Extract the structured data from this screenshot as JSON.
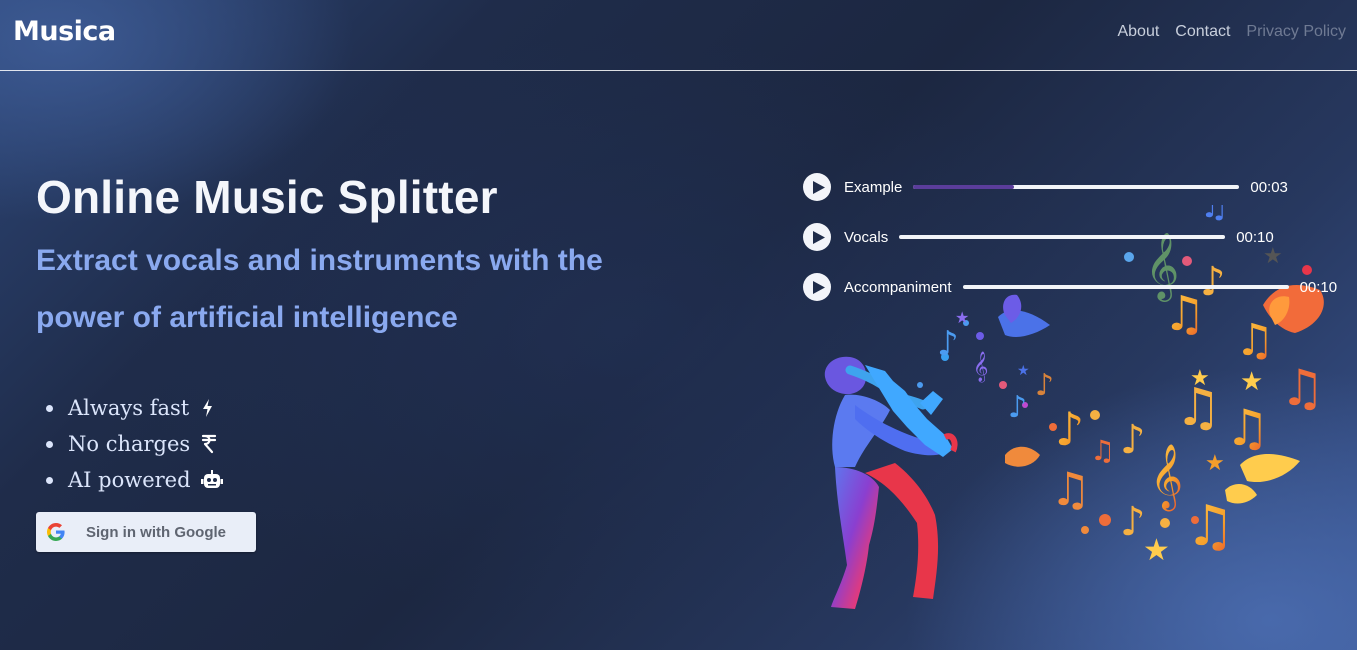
{
  "nav": {
    "brand": "Musica",
    "links": [
      {
        "label": "About"
      },
      {
        "label": "Contact"
      },
      {
        "label": "Privacy Policy"
      }
    ]
  },
  "hero": {
    "title": "Online Music Splitter",
    "subtitle": "Extract vocals and instruments with the power of artificial intelligence"
  },
  "features": [
    {
      "label": "Always fast",
      "icon": "lightning-icon"
    },
    {
      "label": "No charges",
      "icon": "rupee-icon"
    },
    {
      "label": "AI powered",
      "icon": "robot-icon"
    }
  ],
  "signin": {
    "label": "Sign in with Google",
    "icon": "google-icon"
  },
  "players": [
    {
      "name": "Example",
      "time": "00:03",
      "progress": 0.31
    },
    {
      "name": "Vocals",
      "time": "00:10",
      "progress": 0
    },
    {
      "name": "Accompaniment",
      "time": "00:10",
      "progress": 0
    }
  ],
  "colors": {
    "accent_text": "#8aa9ef",
    "progress_fill": "#5b3d9b",
    "background_dark": "#1c2741",
    "background_light": "#3a5693"
  }
}
